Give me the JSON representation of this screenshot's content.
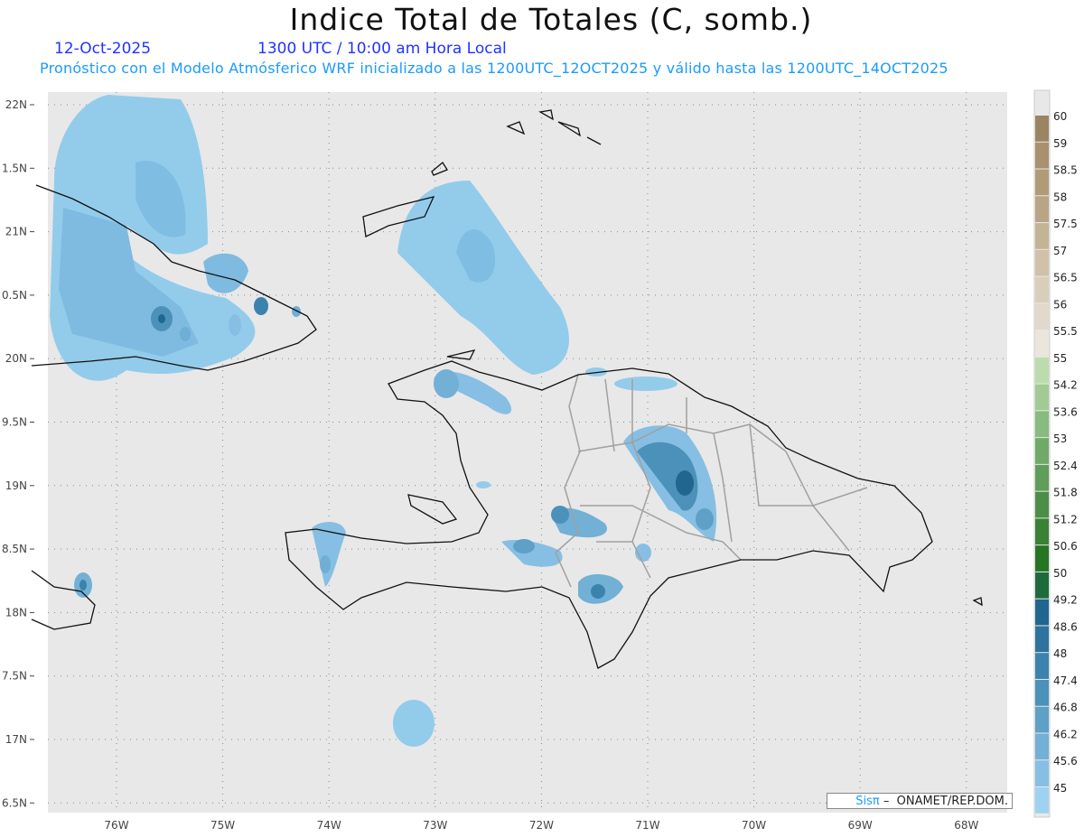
{
  "title": "Indice Total de Totales (C, somb.)",
  "date": "12-Oct-2025",
  "time": "1300 UTC / 10:00 am Hora Local",
  "forecast_info": "Pronóstico con el Modelo Atmósferico WRF inicializado a las 1200UTC_12OCT2025 y válido hasta las  1200UTC_14OCT2025",
  "lon_ticks": [
    "76W",
    "75W",
    "74W",
    "73W",
    "72W",
    "71W",
    "70W",
    "69W",
    "68W"
  ],
  "lat_ticks": [
    "22N",
    "1.5N",
    "21N",
    "0.5N",
    "20N",
    "9.5N",
    "19N",
    "8.5N",
    "18N",
    "7.5N",
    "17N",
    "6.5N"
  ],
  "legend": {
    "labels": [
      "60",
      "59",
      "58.5",
      "58",
      "57.5",
      "57",
      "56.5",
      "56",
      "55.5",
      "55",
      "54.2",
      "53.6",
      "53",
      "52.4",
      "51.8",
      "51.2",
      "50.6",
      "50",
      "49.2",
      "48.6",
      "48",
      "47.4",
      "46.8",
      "46.2",
      "45.6",
      "45"
    ],
    "colors": [
      "#9b8462",
      "#a8916c",
      "#b09b78",
      "#b8a585",
      "#c3b496",
      "#cfc2a9",
      "#d8ceba",
      "#e1d9cb",
      "#ebe6dc",
      "#bcdcae",
      "#a2ca95",
      "#88bb7d",
      "#70aa68",
      "#5e9e58",
      "#4b8f47",
      "#3a8136",
      "#267524",
      "#1d6b3b",
      "#20668f",
      "#2d739d",
      "#3b82ad",
      "#4b91b9",
      "#5ea0c6",
      "#72b0d5",
      "#86bfe3",
      "#9dd2f1"
    ]
  },
  "credit": {
    "brand": "Sisπ",
    "separator": "–",
    "org": "ONAMET/REP.DOM."
  },
  "colors": {
    "map_bg": "#e8e8e8",
    "light_blue": "#93cceb",
    "mid_blue": "#6faed5",
    "dark_blue": "#2f6f99"
  }
}
